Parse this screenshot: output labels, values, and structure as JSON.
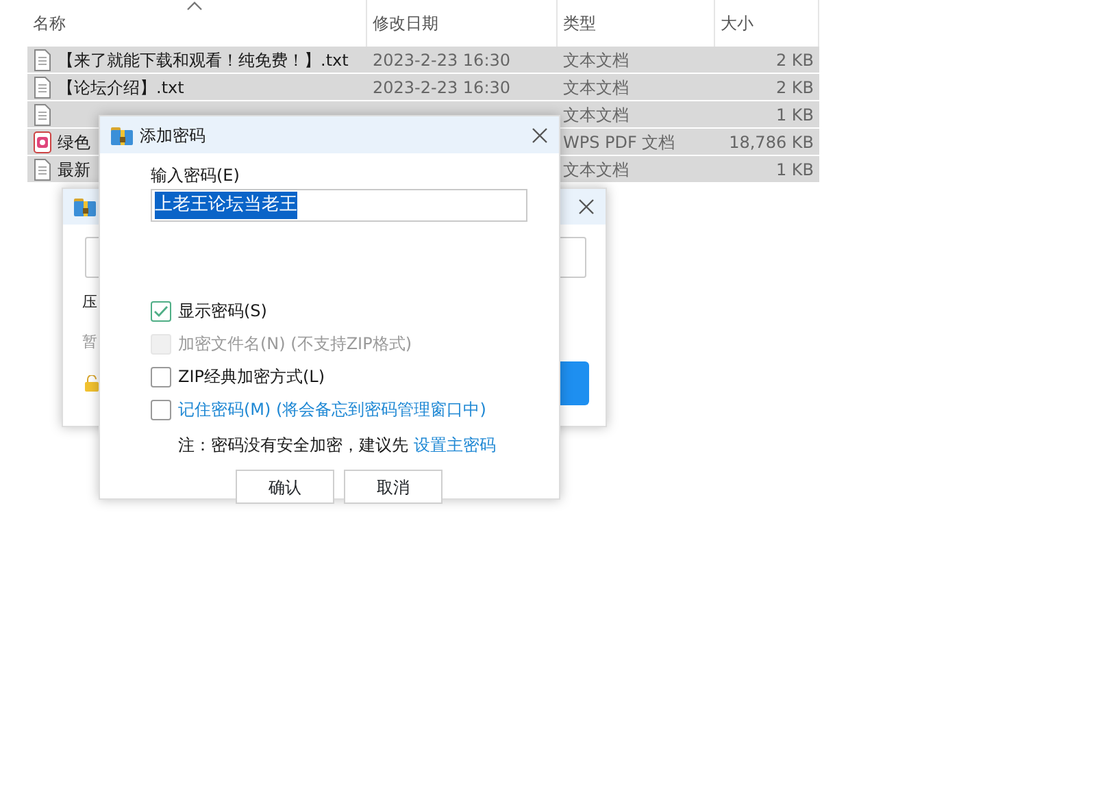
{
  "file_list": {
    "columns": [
      "名称",
      "修改日期",
      "类型",
      "大小"
    ],
    "rows": [
      {
        "kind": "text",
        "selected": true,
        "name": "【来了就能下载和观看！纯免费！】.txt",
        "date": "2023-2-23 16:30",
        "type": "文本文档",
        "size": "2 KB"
      },
      {
        "kind": "text",
        "selected": true,
        "name": "【论坛介绍】.txt",
        "date": "2023-2-23 16:30",
        "type": "文本文档",
        "size": "2 KB"
      },
      {
        "kind": "text",
        "selected": true,
        "type": "文本文档",
        "size": "1 KB"
      },
      {
        "kind": "pdf",
        "selected": true,
        "name": "绿色",
        "type": "WPS PDF 文档",
        "size": "18,786 KB"
      },
      {
        "kind": "text",
        "selected": true,
        "name": "最新",
        "type": "文本文档",
        "size": "1 KB"
      }
    ]
  },
  "back_dialog": {
    "row_label": "压",
    "hint_text": "暂"
  },
  "password_dialog": {
    "title": "添加密码",
    "password_label": "输入密码(E)",
    "password_value": "上老王论坛当老王",
    "value_selected": true,
    "options": [
      {
        "kind": "plain",
        "label": "显示密码(S)",
        "checked": true,
        "disabled": false
      },
      {
        "kind": "plain",
        "label": "加密文件名(N) (不支持ZIP格式)",
        "checked": false,
        "disabled": true
      },
      {
        "kind": "plain",
        "label": "ZIP经典加密方式(L)",
        "checked": false,
        "disabled": false
      },
      {
        "kind": "link",
        "label": "记住密码(M) (将会备忘到密码管理窗口中)",
        "checked": false,
        "disabled": false
      }
    ],
    "note": "注：密码没有安全加密，建议先",
    "note_link": "设置主密码",
    "buttons": [
      "确认",
      "取消"
    ]
  }
}
